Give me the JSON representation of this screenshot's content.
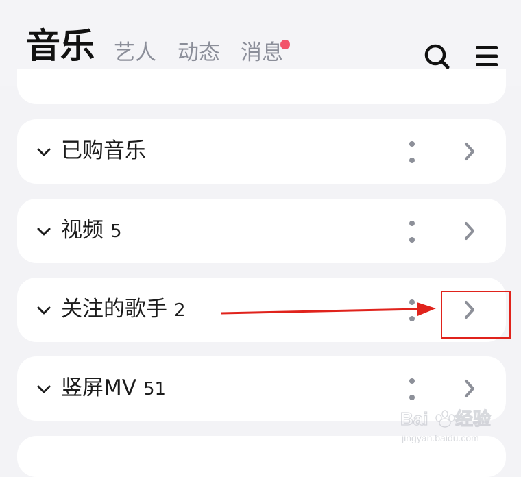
{
  "header": {
    "tabs": [
      {
        "label": "音乐",
        "active": true
      },
      {
        "label": "艺人"
      },
      {
        "label": "动态"
      },
      {
        "label": "消息",
        "has_badge": true
      }
    ],
    "icons": [
      "search-icon",
      "menu-icon"
    ]
  },
  "list": {
    "rows": [
      {
        "label": "已购音乐",
        "count": ""
      },
      {
        "label": "视频",
        "count": "5"
      },
      {
        "label": "关注的歌手",
        "count": "2"
      },
      {
        "label": "竖屏MV",
        "count": "51"
      }
    ]
  },
  "watermark": {
    "brand": "Baidu经验",
    "url": "jingyan.baidu.com"
  },
  "colors": {
    "accent_dot": "#1aa7ee",
    "badge": "#f2546a",
    "annotation": "#e0231c",
    "background": "#f3f3f6",
    "card": "#ffffff"
  }
}
